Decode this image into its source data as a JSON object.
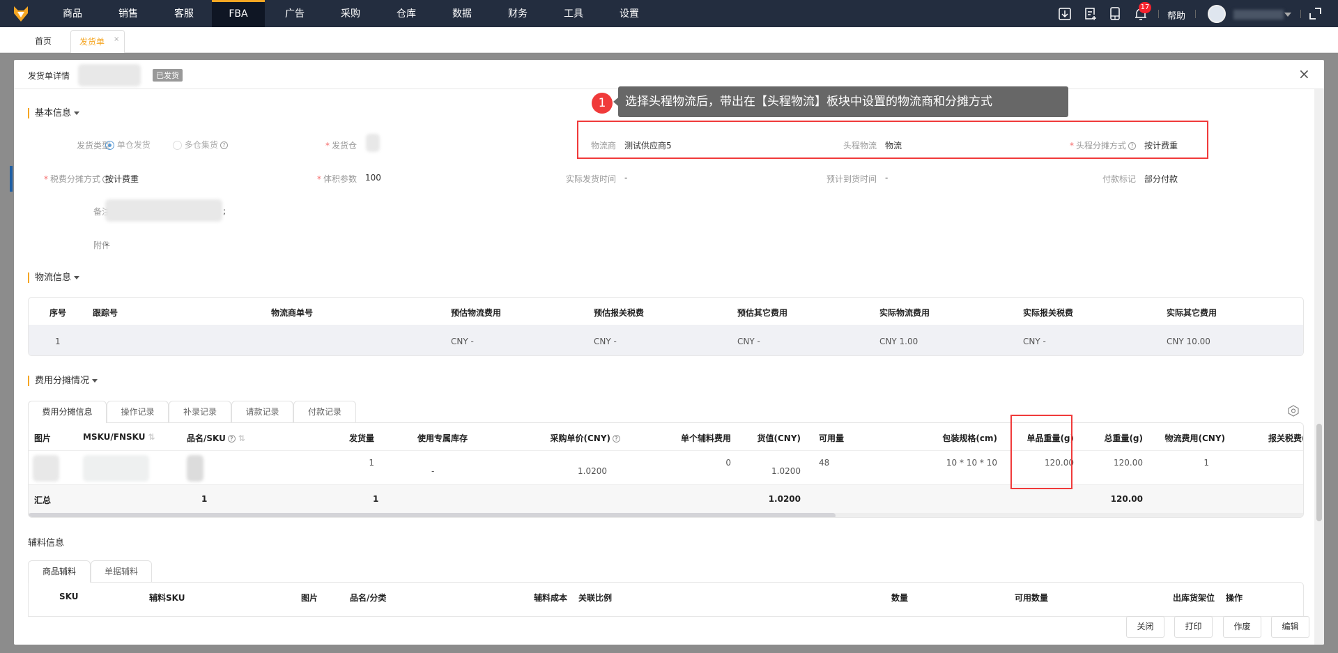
{
  "nav": {
    "items": [
      "商品",
      "销售",
      "客服",
      "FBA",
      "广告",
      "采购",
      "仓库",
      "数据",
      "财务",
      "工具",
      "设置"
    ],
    "active": "FBA",
    "notification_count": "17",
    "help": "帮助",
    "icons": [
      "download-icon",
      "document-add-icon",
      "mobile-icon",
      "bell-icon",
      "user-avatar-icon",
      "expand-icon"
    ]
  },
  "tabs": {
    "home": "首页",
    "current": "发货单",
    "close": "×"
  },
  "modal": {
    "title": "发货单详情",
    "status": "已发货",
    "close": "×",
    "tooltip": {
      "number": "1",
      "text": "选择头程物流后，带出在【头程物流】板块中设置的物流商和分摊方式"
    },
    "basic": {
      "title": "基本信息",
      "ship_type_label": "发货类型",
      "ship_type_opt1": "单仓发货",
      "ship_type_opt2": "多仓集货",
      "warehouse_label": "发货仓",
      "carrier_label": "物流商",
      "carrier_value": "测试供应商5",
      "first_leg_label": "头程物流",
      "first_leg_value": "物流",
      "first_leg_alloc_label": "头程分摊方式",
      "first_leg_alloc_value": "按计费重",
      "tax_alloc_label": "税费分摊方式",
      "tax_alloc_value": "按计费重",
      "volume_label": "体积参数",
      "volume_value": "100",
      "actual_ship_label": "实际发货时间",
      "actual_ship_value": "-",
      "eta_label": "预计到货时间",
      "eta_value": "-",
      "payment_label": "付款标记",
      "payment_value": "部分付款",
      "remark_label": "备注",
      "remark_suffix": ";",
      "attachment_label": "附件",
      "attachment_value": "-"
    },
    "logistics": {
      "title": "物流信息",
      "columns": [
        "序号",
        "跟踪号",
        "物流商单号",
        "预估物流费用",
        "预估报关税费",
        "预估其它费用",
        "实际物流费用",
        "实际报关税费",
        "实际其它费用"
      ],
      "rows": [
        [
          "1",
          "",
          "",
          "CNY -",
          "CNY -",
          "CNY -",
          "CNY 1.00",
          "CNY -",
          "CNY 10.00"
        ]
      ]
    },
    "cost": {
      "title": "费用分摊情况",
      "tabs": [
        "费用分摊信息",
        "操作记录",
        "补录记录",
        "请款记录",
        "付款记录"
      ],
      "columns": [
        "图片",
        "MSKU/FNSKU",
        "品名/SKU",
        "发货量",
        "使用专属库存",
        "采购单价(CNY)",
        "单个辅料费用",
        "货值(CNY)",
        "可用量",
        "包装规格(cm)",
        "单品重量(g)",
        "总重量(g)",
        "物流费用(CNY)",
        "报关税费("
      ],
      "row": {
        "qty": "1",
        "exclusive": "-",
        "unit_price": "1.0200",
        "aux_fee": "0",
        "goods_value": "1.0200",
        "available": "48",
        "package": "10 * 10 * 10",
        "unit_weight": "120.00",
        "total_weight": "120.00",
        "logistics_fee": "1"
      },
      "total": {
        "label": "汇总",
        "msku": "1",
        "qty": "1",
        "goods_value": "1.0200",
        "total_weight": "120.00"
      }
    },
    "aux": {
      "title": "辅料信息",
      "tabs": [
        "商品辅料",
        "单据辅料"
      ],
      "columns": [
        "SKU",
        "辅料SKU",
        "图片",
        "品名/分类",
        "辅料成本",
        "关联比例",
        "数量",
        "可用数量",
        "出库货架位",
        "操作"
      ]
    },
    "buttons": {
      "close": "关闭",
      "print": "打印",
      "void": "作废",
      "edit": "编辑"
    }
  }
}
